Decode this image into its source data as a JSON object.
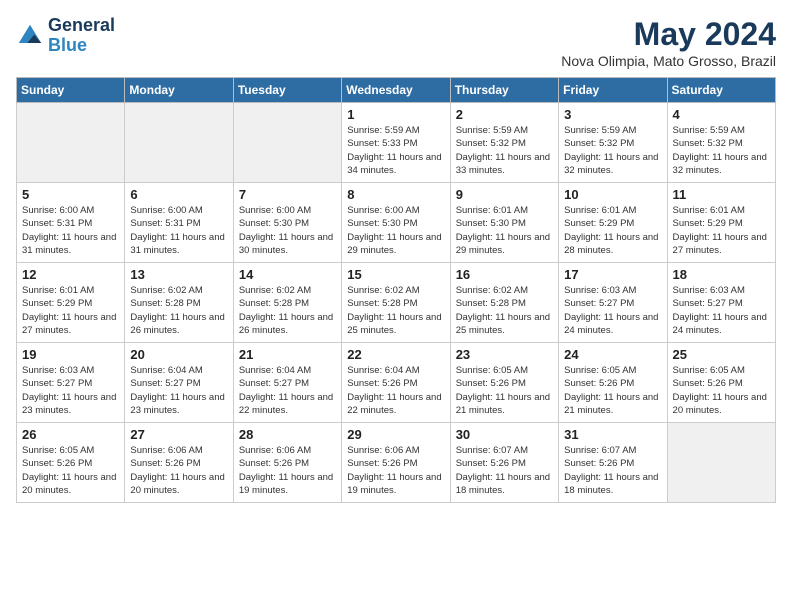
{
  "header": {
    "logo_line1": "General",
    "logo_line2": "Blue",
    "month_title": "May 2024",
    "location": "Nova Olimpia, Mato Grosso, Brazil"
  },
  "days_of_week": [
    "Sunday",
    "Monday",
    "Tuesday",
    "Wednesday",
    "Thursday",
    "Friday",
    "Saturday"
  ],
  "weeks": [
    [
      {
        "day": "",
        "empty": true
      },
      {
        "day": "",
        "empty": true
      },
      {
        "day": "",
        "empty": true
      },
      {
        "day": "1",
        "sunrise": "5:59 AM",
        "sunset": "5:33 PM",
        "daylight": "11 hours and 34 minutes."
      },
      {
        "day": "2",
        "sunrise": "5:59 AM",
        "sunset": "5:32 PM",
        "daylight": "11 hours and 33 minutes."
      },
      {
        "day": "3",
        "sunrise": "5:59 AM",
        "sunset": "5:32 PM",
        "daylight": "11 hours and 32 minutes."
      },
      {
        "day": "4",
        "sunrise": "5:59 AM",
        "sunset": "5:32 PM",
        "daylight": "11 hours and 32 minutes."
      }
    ],
    [
      {
        "day": "5",
        "sunrise": "6:00 AM",
        "sunset": "5:31 PM",
        "daylight": "11 hours and 31 minutes."
      },
      {
        "day": "6",
        "sunrise": "6:00 AM",
        "sunset": "5:31 PM",
        "daylight": "11 hours and 31 minutes."
      },
      {
        "day": "7",
        "sunrise": "6:00 AM",
        "sunset": "5:30 PM",
        "daylight": "11 hours and 30 minutes."
      },
      {
        "day": "8",
        "sunrise": "6:00 AM",
        "sunset": "5:30 PM",
        "daylight": "11 hours and 29 minutes."
      },
      {
        "day": "9",
        "sunrise": "6:01 AM",
        "sunset": "5:30 PM",
        "daylight": "11 hours and 29 minutes."
      },
      {
        "day": "10",
        "sunrise": "6:01 AM",
        "sunset": "5:29 PM",
        "daylight": "11 hours and 28 minutes."
      },
      {
        "day": "11",
        "sunrise": "6:01 AM",
        "sunset": "5:29 PM",
        "daylight": "11 hours and 27 minutes."
      }
    ],
    [
      {
        "day": "12",
        "sunrise": "6:01 AM",
        "sunset": "5:29 PM",
        "daylight": "11 hours and 27 minutes."
      },
      {
        "day": "13",
        "sunrise": "6:02 AM",
        "sunset": "5:28 PM",
        "daylight": "11 hours and 26 minutes."
      },
      {
        "day": "14",
        "sunrise": "6:02 AM",
        "sunset": "5:28 PM",
        "daylight": "11 hours and 26 minutes."
      },
      {
        "day": "15",
        "sunrise": "6:02 AM",
        "sunset": "5:28 PM",
        "daylight": "11 hours and 25 minutes."
      },
      {
        "day": "16",
        "sunrise": "6:02 AM",
        "sunset": "5:28 PM",
        "daylight": "11 hours and 25 minutes."
      },
      {
        "day": "17",
        "sunrise": "6:03 AM",
        "sunset": "5:27 PM",
        "daylight": "11 hours and 24 minutes."
      },
      {
        "day": "18",
        "sunrise": "6:03 AM",
        "sunset": "5:27 PM",
        "daylight": "11 hours and 24 minutes."
      }
    ],
    [
      {
        "day": "19",
        "sunrise": "6:03 AM",
        "sunset": "5:27 PM",
        "daylight": "11 hours and 23 minutes."
      },
      {
        "day": "20",
        "sunrise": "6:04 AM",
        "sunset": "5:27 PM",
        "daylight": "11 hours and 23 minutes."
      },
      {
        "day": "21",
        "sunrise": "6:04 AM",
        "sunset": "5:27 PM",
        "daylight": "11 hours and 22 minutes."
      },
      {
        "day": "22",
        "sunrise": "6:04 AM",
        "sunset": "5:26 PM",
        "daylight": "11 hours and 22 minutes."
      },
      {
        "day": "23",
        "sunrise": "6:05 AM",
        "sunset": "5:26 PM",
        "daylight": "11 hours and 21 minutes."
      },
      {
        "day": "24",
        "sunrise": "6:05 AM",
        "sunset": "5:26 PM",
        "daylight": "11 hours and 21 minutes."
      },
      {
        "day": "25",
        "sunrise": "6:05 AM",
        "sunset": "5:26 PM",
        "daylight": "11 hours and 20 minutes."
      }
    ],
    [
      {
        "day": "26",
        "sunrise": "6:05 AM",
        "sunset": "5:26 PM",
        "daylight": "11 hours and 20 minutes."
      },
      {
        "day": "27",
        "sunrise": "6:06 AM",
        "sunset": "5:26 PM",
        "daylight": "11 hours and 20 minutes."
      },
      {
        "day": "28",
        "sunrise": "6:06 AM",
        "sunset": "5:26 PM",
        "daylight": "11 hours and 19 minutes."
      },
      {
        "day": "29",
        "sunrise": "6:06 AM",
        "sunset": "5:26 PM",
        "daylight": "11 hours and 19 minutes."
      },
      {
        "day": "30",
        "sunrise": "6:07 AM",
        "sunset": "5:26 PM",
        "daylight": "11 hours and 18 minutes."
      },
      {
        "day": "31",
        "sunrise": "6:07 AM",
        "sunset": "5:26 PM",
        "daylight": "11 hours and 18 minutes."
      },
      {
        "day": "",
        "empty": true
      }
    ]
  ]
}
